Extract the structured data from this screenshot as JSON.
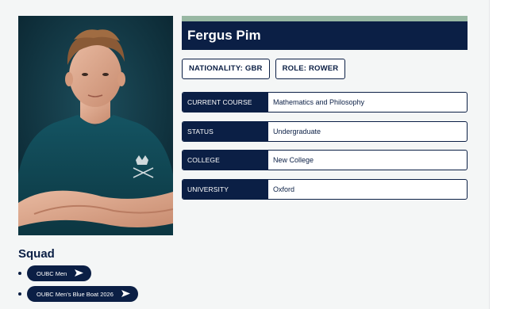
{
  "profile": {
    "name": "Fergus Pim",
    "tags": [
      "NATIONALITY: GBR",
      "ROLE: ROWER"
    ],
    "details": [
      {
        "key": "CURRENT COURSE",
        "value": "Mathematics and Philosophy"
      },
      {
        "key": "STATUS",
        "value": "Undergraduate"
      },
      {
        "key": "COLLEGE",
        "value": "New College"
      },
      {
        "key": "UNIVERSITY",
        "value": "Oxford"
      }
    ]
  },
  "squad": {
    "heading": "Squad",
    "items": [
      "OUBC Men",
      "OUBC Men's Blue Boat 2026"
    ]
  },
  "icons": {
    "squad_link": "paper-plane-icon"
  },
  "colors": {
    "navy": "#0b1f45",
    "sage": "#98b8a3",
    "background": "#f4f6f6",
    "jersey": "#0f4350"
  }
}
